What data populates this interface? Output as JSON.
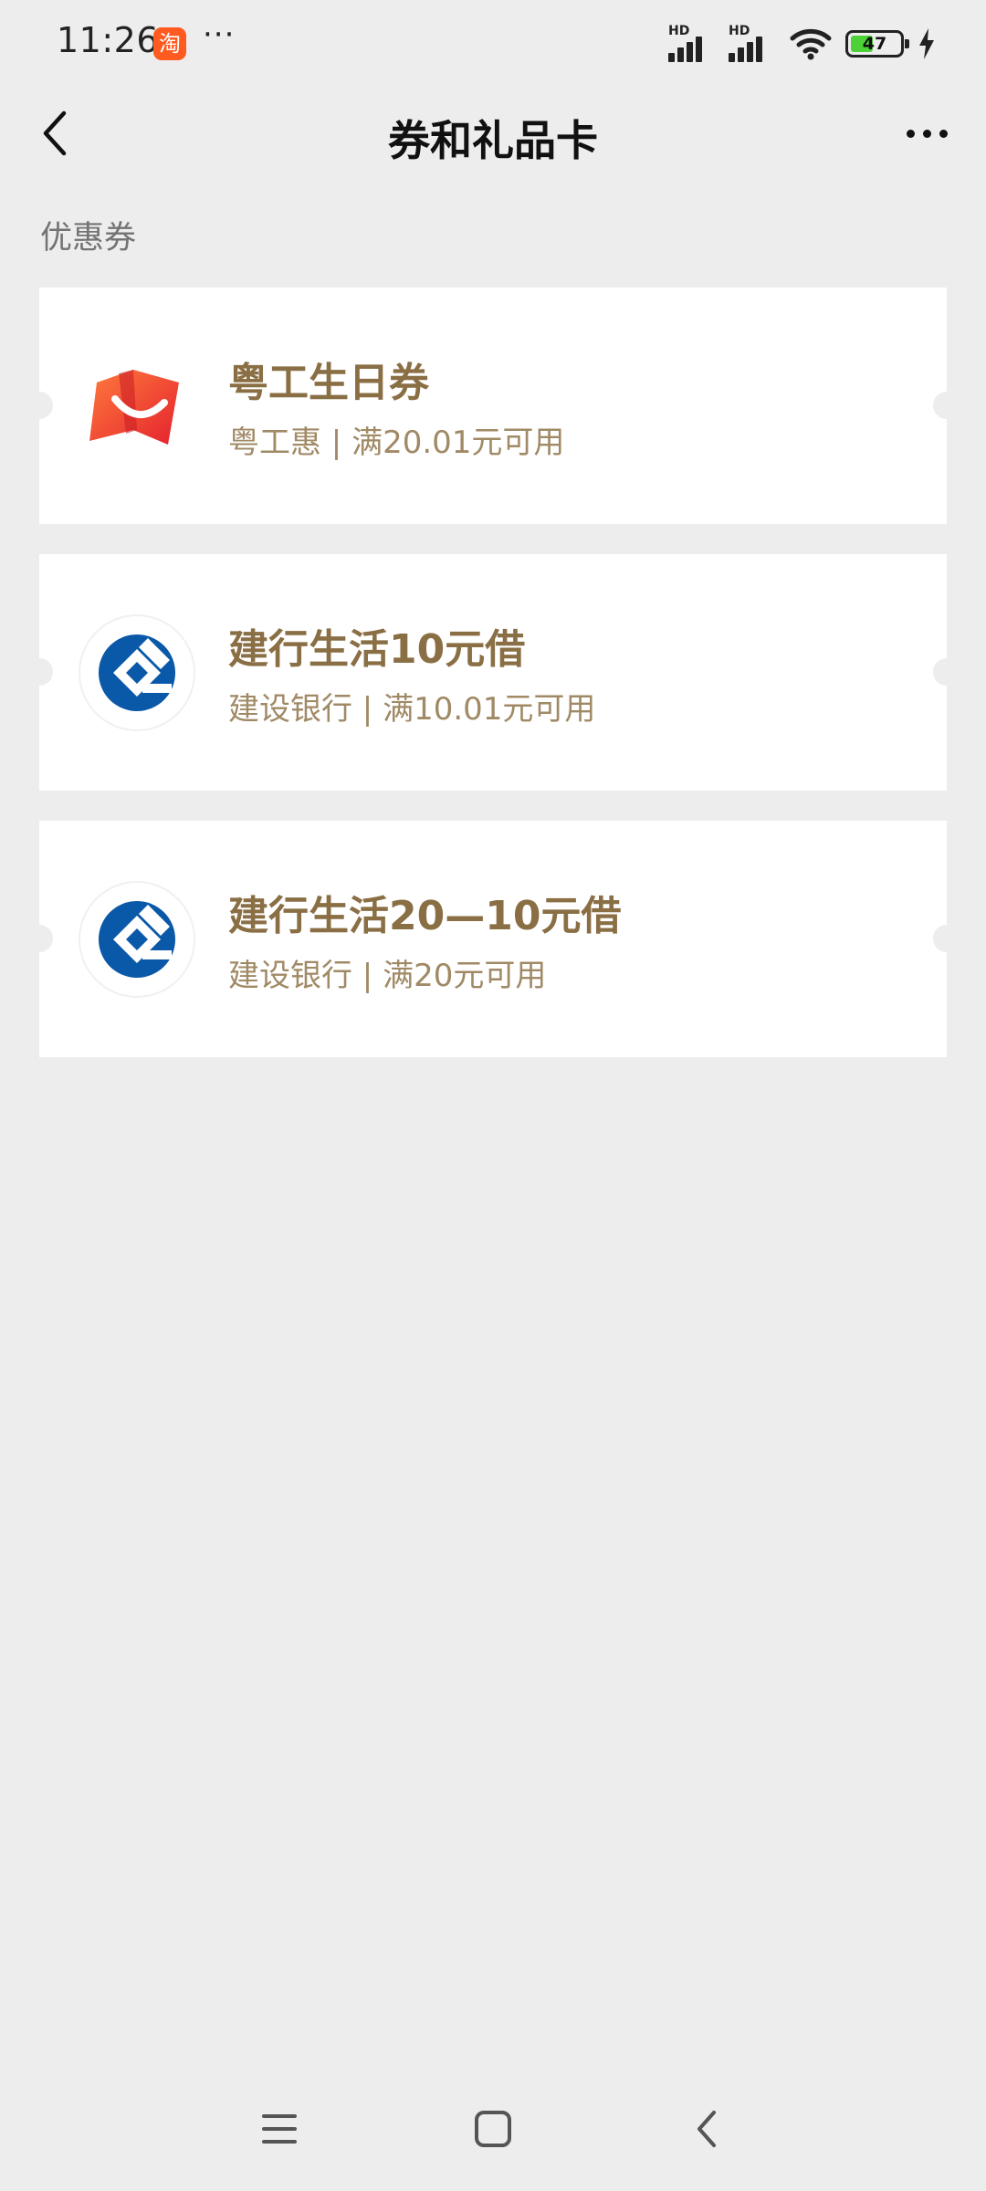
{
  "status_bar": {
    "time": "11:26",
    "taobao_glyph": "淘",
    "more_indicator": "···",
    "signal1_label": "HD",
    "signal2_label": "HD",
    "battery_level": 47,
    "battery_text": "47",
    "icons": [
      "taobao-app-icon",
      "signal-icon",
      "wifi-icon",
      "battery-icon",
      "charging-icon"
    ]
  },
  "nav": {
    "title": "券和礼品卡",
    "back_icon": "chevron-left-icon",
    "more_icon": "more-horizontal-icon"
  },
  "section": {
    "label": "优惠券"
  },
  "coupons": [
    {
      "title": "粤工生日券",
      "desc": "粤工惠 | 满20.01元可用",
      "logo": "yuegonghui-logo-icon",
      "logo_colors": [
        "#ff5d3a",
        "#e8262d"
      ]
    },
    {
      "title": "建行生活10元借",
      "desc": "建设银行 | 满10.01元可用",
      "logo": "ccb-logo-icon",
      "logo_colors": [
        "#0a58a8"
      ]
    },
    {
      "title": "建行生活20—10元借",
      "desc": "建设银行 | 满20元可用",
      "logo": "ccb-logo-icon",
      "logo_colors": [
        "#0a58a8"
      ]
    }
  ],
  "colors": {
    "background": "#ededed",
    "card": "#ffffff",
    "coupon_title": "#8a6f45",
    "coupon_desc": "#a08a66",
    "section_label": "#737373"
  },
  "system_nav": {
    "icons": [
      "menu-icon",
      "home-icon",
      "back-icon"
    ]
  }
}
